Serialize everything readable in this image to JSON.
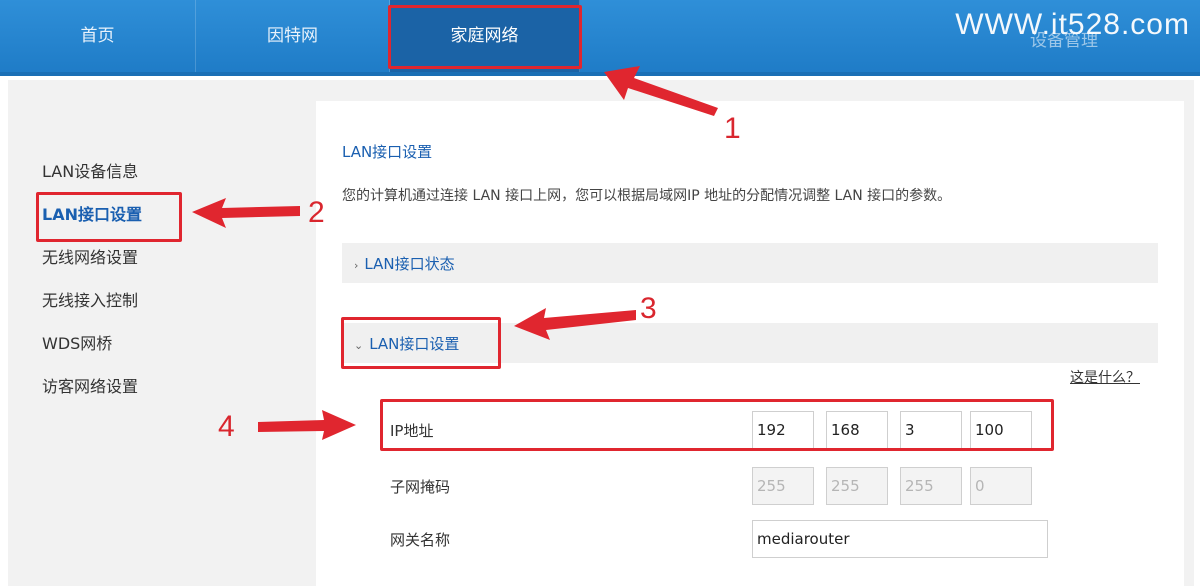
{
  "nav": {
    "tabs": [
      {
        "label": "首页"
      },
      {
        "label": "因特网"
      },
      {
        "label": "家庭网络"
      }
    ],
    "right_partial": "设备管理",
    "watermark": "WWW.it528.com"
  },
  "sidebar": {
    "items": [
      {
        "label": "LAN设备信息"
      },
      {
        "label": "LAN接口设置"
      },
      {
        "label": "无线网络设置"
      },
      {
        "label": "无线接入控制"
      },
      {
        "label": "WDS网桥"
      },
      {
        "label": "访客网络设置"
      }
    ]
  },
  "main": {
    "title": "LAN接口设置",
    "description": "您的计算机通过连接 LAN 接口上网，您可以根据局域网IP 地址的分配情况调整 LAN 接口的参数。",
    "status_section": "LAN接口状态",
    "settings_section": "LAN接口设置",
    "help_link": "这是什么？",
    "fields": {
      "ip_label": "IP地址",
      "ip": [
        "192",
        "168",
        "3",
        "100"
      ],
      "mask_label": "子网掩码",
      "mask": [
        "255",
        "255",
        "255",
        "0"
      ],
      "gateway_label": "网关名称",
      "gateway_value": "mediarouter"
    }
  },
  "annotations": {
    "n1": "1",
    "n2": "2",
    "n3": "3",
    "n4": "4",
    "color": "#e0262f"
  },
  "colors": {
    "nav_blue": "#2585d2",
    "nav_active": "#1b63a6",
    "link_blue": "#1a5fb0"
  }
}
